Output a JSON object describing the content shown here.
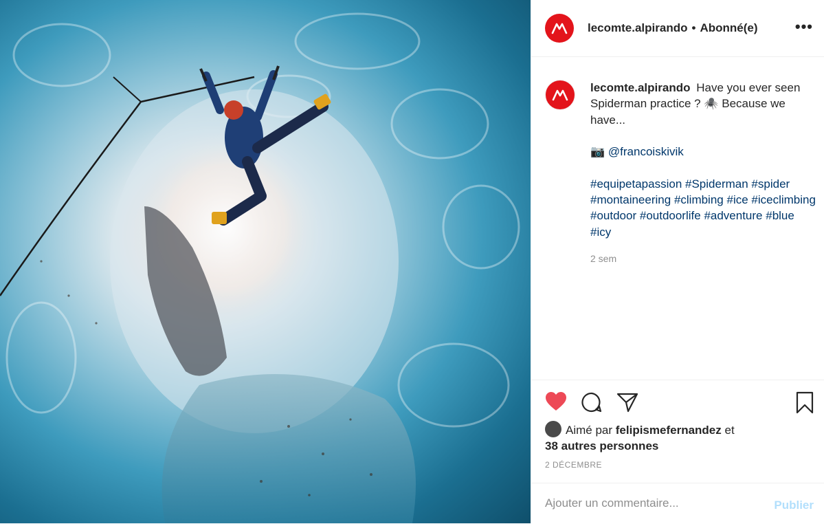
{
  "post": {
    "image_description_icon": "ice-cave-climber-photo"
  },
  "header": {
    "username": "lecomte.alpirando",
    "separator": "•",
    "follow_status": "Abonné(e)",
    "more_icon": "more-horizontal-icon"
  },
  "caption": {
    "username": "lecomte.alpirando",
    "line1": "Have you ever seen Spiderman practice ? 🕷️  Because we have...",
    "camera_emoji": "📷",
    "mention": "@francoiskivik",
    "hashtags": [
      "#equipetapassion",
      "#Spiderman",
      "#spider",
      "#montaineering",
      "#climbing",
      "#ice",
      "#iceclimbing",
      "#outdoor",
      "#outdoorlife",
      "#adventure",
      "#blue",
      "#icy"
    ],
    "time": "2 sem"
  },
  "actions": {
    "liked": true,
    "like_color": "#ed4956"
  },
  "likes": {
    "prefix": "Aimé par",
    "user": "felipismefernandez",
    "conj": "et",
    "others": "38 autres personnes"
  },
  "date": "2 DÉCEMBRE",
  "comment": {
    "placeholder": "Ajouter un commentaire...",
    "publish": "Publier"
  },
  "colors": {
    "brand": "#e3141b",
    "link": "#00376b",
    "muted": "#8e8e8e",
    "publish_disabled": "#b2dffc"
  }
}
